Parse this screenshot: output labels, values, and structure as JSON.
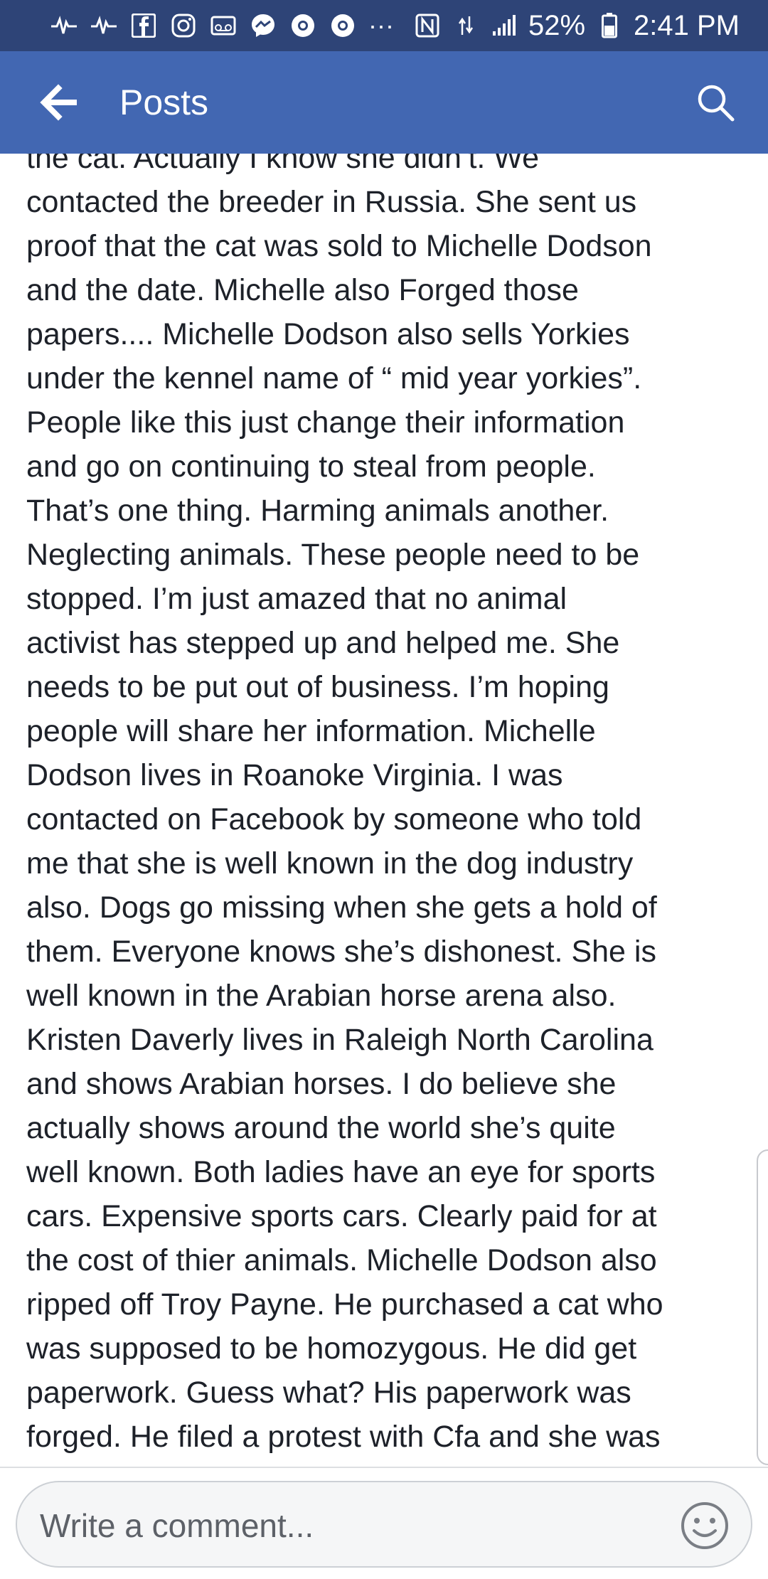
{
  "status_bar": {
    "notification_icons": [
      "pulse-icon",
      "pulse-icon",
      "facebook-icon",
      "instagram-icon",
      "voicemail-icon",
      "messenger-icon",
      "chrome-icon",
      "chrome-icon"
    ],
    "overflow": "···",
    "battery": "52%",
    "time": "2:41 PM"
  },
  "app_bar": {
    "title": "Posts"
  },
  "post": {
    "lines": [
      "the cat. Actually I know she didn’t. We",
      "contacted the breeder in Russia. She sent us",
      "proof that the cat was sold to Michelle Dodson",
      "and the date. Michelle also Forged  those",
      "papers.... Michelle Dodson also sells Yorkies",
      "under the kennel name of “ mid year yorkies”.",
      "People like this just change their information",
      "and go on continuing to steal from people.",
      "That’s one thing.  Harming animals another.",
      "Neglecting animals. These people need to be",
      "stopped. I’m just amazed that no animal",
      "activist has stepped up and helped me. She",
      "needs to be put out of business. I’m hoping",
      "people will share her information. Michelle",
      "Dodson lives in Roanoke Virginia. I was",
      "contacted on Facebook by someone who told",
      "me that she is well known in the dog industry",
      "also. Dogs go missing when she gets a hold of",
      "them. Everyone knows she’s dishonest. She is",
      "well known in the Arabian horse arena also.",
      "Kristen Daverly lives in Raleigh North Carolina",
      "and shows Arabian horses. I do believe she",
      "actually shows around the world she’s quite",
      "well known. Both ladies have an eye for sports",
      "cars. Expensive sports cars. Clearly paid for at",
      "the cost of thier animals. Michelle Dodson also",
      "ripped off Troy Payne. He purchased a cat who",
      "was supposed to be homozygous. He did get",
      "paperwork. Guess what? His paperwork was",
      "forged. He filed a protest with Cfa and she was"
    ]
  },
  "comment": {
    "placeholder": "Write a comment..."
  }
}
